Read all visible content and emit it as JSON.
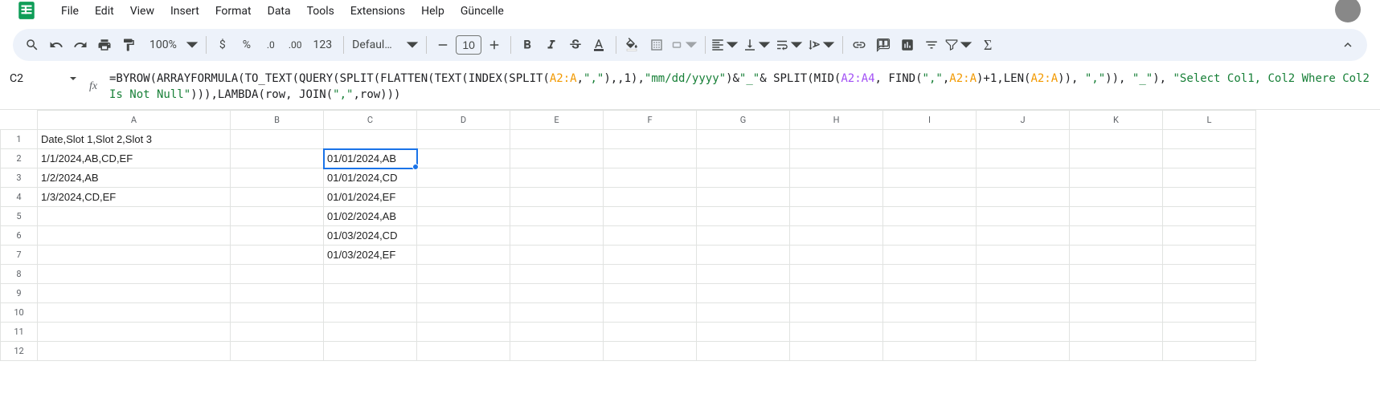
{
  "menu": [
    "File",
    "Edit",
    "View",
    "Insert",
    "Format",
    "Data",
    "Tools",
    "Extensions",
    "Help",
    "Güncelle"
  ],
  "toolbar": {
    "zoom": "100%",
    "font": "Defaul…",
    "font_size": "10"
  },
  "namebox": "C2",
  "formula_parts": [
    {
      "t": "fn",
      "v": "=BYROW(ARRAYFORMULA(TO_TEXT(QUERY(SPLIT(FLATTEN(TEXT(INDEX(SPLIT("
    },
    {
      "t": "ref1",
      "v": "A2:A"
    },
    {
      "t": "fn",
      "v": ","
    },
    {
      "t": "str",
      "v": "\",\""
    },
    {
      "t": "fn",
      "v": "),,1),"
    },
    {
      "t": "str",
      "v": "\"mm/dd/yyyy\""
    },
    {
      "t": "fn",
      "v": ")&"
    },
    {
      "t": "str",
      "v": "\"_\""
    },
    {
      "t": "fn",
      "v": "& SPLIT(MID("
    },
    {
      "t": "ref3",
      "v": "A2:A4"
    },
    {
      "t": "fn",
      "v": ", FIND("
    },
    {
      "t": "str",
      "v": "\",\""
    },
    {
      "t": "fn",
      "v": ","
    },
    {
      "t": "ref1",
      "v": "A2:A"
    },
    {
      "t": "fn",
      "v": ")+1,LEN("
    },
    {
      "t": "ref1",
      "v": "A2:A"
    },
    {
      "t": "fn",
      "v": ")), "
    },
    {
      "t": "str",
      "v": "\",\""
    },
    {
      "t": "fn",
      "v": ")), "
    },
    {
      "t": "str",
      "v": "\"_\""
    },
    {
      "t": "fn",
      "v": "), "
    },
    {
      "t": "str",
      "v": "\"Select Col1, Col2 Where Col2 Is Not Null\""
    },
    {
      "t": "fn",
      "v": "))),LAMBDA(row, JOIN("
    },
    {
      "t": "str",
      "v": "\",\""
    },
    {
      "t": "fn",
      "v": ",row)))"
    }
  ],
  "columns": [
    "A",
    "B",
    "C",
    "D",
    "E",
    "F",
    "G",
    "H",
    "I",
    "J",
    "K",
    "L"
  ],
  "rows": 12,
  "selected_cell": {
    "row": 2,
    "col": "C"
  },
  "cells": {
    "A1": "Date,Slot 1,Slot 2,Slot 3",
    "A2": "1/1/2024,AB,CD,EF",
    "A3": "1/2/2024,AB",
    "A4": "1/3/2024,CD,EF",
    "C2": "01/01/2024,AB",
    "C3": "01/01/2024,CD",
    "C4": "01/01/2024,EF",
    "C5": "01/02/2024,AB",
    "C6": "01/03/2024,CD",
    "C7": "01/03/2024,EF"
  },
  "chart_data": null
}
